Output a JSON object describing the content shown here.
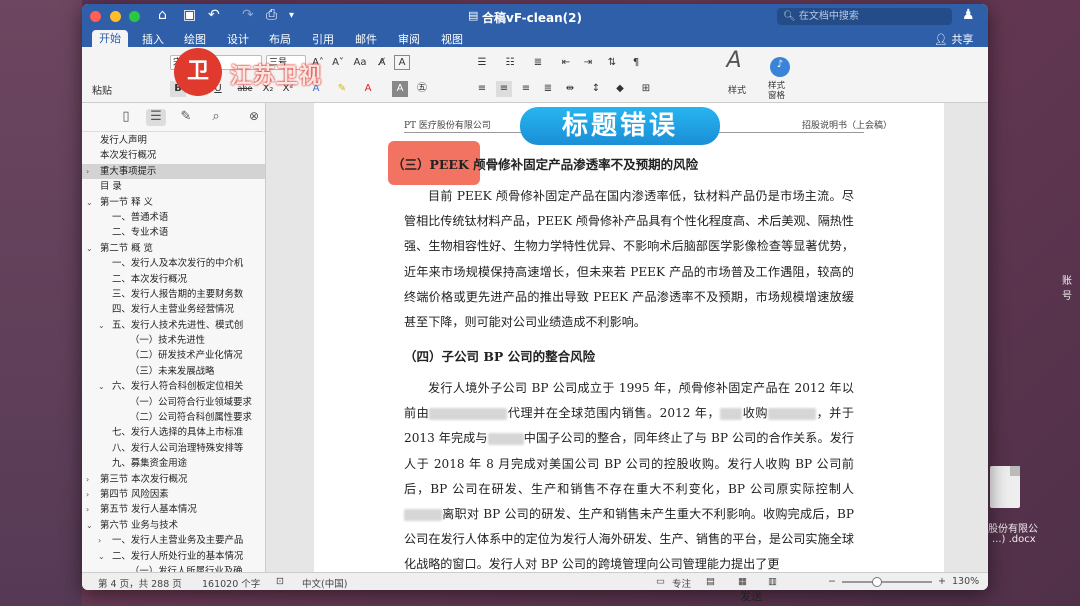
{
  "window": {
    "title": "合稿vF-clean(2)",
    "search_placeholder": "在文档中搜索"
  },
  "tabs": [
    "开始",
    "插入",
    "绘图",
    "设计",
    "布局",
    "引用",
    "邮件",
    "审阅",
    "视图"
  ],
  "share_label": "共享",
  "ribbon": {
    "paste_label": "粘贴",
    "font_name": "宋体",
    "font_size": "三号",
    "styles_label": "样式",
    "styles_pane_label": "样式\n窗格"
  },
  "watermark": {
    "logo_text": "江苏卫视"
  },
  "toc": [
    {
      "label": "发行人声明",
      "indent": 1,
      "arrow": ""
    },
    {
      "label": "本次发行概况",
      "indent": 1,
      "arrow": ""
    },
    {
      "label": "重大事项提示",
      "indent": 1,
      "arrow": "›",
      "selected": true
    },
    {
      "label": "目  录",
      "indent": 1,
      "arrow": ""
    },
    {
      "label": "第一节  释  义",
      "indent": 1,
      "arrow": "⌄"
    },
    {
      "label": "一、普通术语",
      "indent": 2,
      "arrow": ""
    },
    {
      "label": "二、专业术语",
      "indent": 2,
      "arrow": ""
    },
    {
      "label": "第二节  概  览",
      "indent": 1,
      "arrow": "⌄"
    },
    {
      "label": "一、发行人及本次发行的中介机",
      "indent": 2,
      "arrow": ""
    },
    {
      "label": "二、本次发行概况",
      "indent": 2,
      "arrow": ""
    },
    {
      "label": "三、发行人报告期的主要财务数",
      "indent": 2,
      "arrow": ""
    },
    {
      "label": "四、发行人主营业务经营情况",
      "indent": 2,
      "arrow": ""
    },
    {
      "label": "五、发行人技术先进性、模式创",
      "indent": 2,
      "arrow": "⌄"
    },
    {
      "label": "（一）技术先进性",
      "indent": 3,
      "arrow": ""
    },
    {
      "label": "（二）研发技术产业化情况",
      "indent": 3,
      "arrow": ""
    },
    {
      "label": "（三）未来发展战略",
      "indent": 3,
      "arrow": ""
    },
    {
      "label": "六、发行人符合科创板定位相关",
      "indent": 2,
      "arrow": "⌄"
    },
    {
      "label": "（一）公司符合行业领域要求",
      "indent": 3,
      "arrow": ""
    },
    {
      "label": "（二）公司符合科创属性要求",
      "indent": 3,
      "arrow": ""
    },
    {
      "label": "七、发行人选择的具体上市标准",
      "indent": 2,
      "arrow": ""
    },
    {
      "label": "八、发行人公司治理特殊安排等",
      "indent": 2,
      "arrow": ""
    },
    {
      "label": "九、募集资金用途",
      "indent": 2,
      "arrow": ""
    },
    {
      "label": "第三节  本次发行概况",
      "indent": 1,
      "arrow": "›"
    },
    {
      "label": "第四节  风险因素",
      "indent": 1,
      "arrow": "›"
    },
    {
      "label": "第五节  发行人基本情况",
      "indent": 1,
      "arrow": "›"
    },
    {
      "label": "第六节  业务与技术",
      "indent": 1,
      "arrow": "⌄"
    },
    {
      "label": "一、发行人主营业务及主要产品",
      "indent": 2,
      "arrow": "›"
    },
    {
      "label": "二、发行人所处行业的基本情况",
      "indent": 2,
      "arrow": "⌄"
    },
    {
      "label": "（一）发行人所属行业及确",
      "indent": 3,
      "arrow": ""
    }
  ],
  "document": {
    "header_left": "PT  医疗股份有限公司",
    "header_right": "招股说明书（上会稿）",
    "banner": "标题错误",
    "section3_heading": "（三）PEEK 颅骨修补固定产品渗透率不及预期的风险",
    "section3_text": "目前 PEEK 颅骨修补固定产品在国内渗透率低，钛材料产品仍是市场主流。尽管相比传统钛材料产品，PEEK 颅骨修补产品具有个性化程度高、术后美观、隔热性强、生物相容性好、生物力学特性优异、不影响术后脑部医学影像检查等显著优势，近年来市场规模保持高速增长，但未来若 PEEK 产品的市场普及工作遇阻，较高的终端价格或更先进产品的推出导致 PEEK 产品渗透率不及预期，市场规模增速放缓甚至下降，则可能对公司业绩造成不利影响。",
    "section4_heading": "（四）子公司 BP 公司的整合风险",
    "section4_text_1": "发行人境外子公司 BP 公司成立于 1995 年，颅骨修补固定产品在 2012 年以前由",
    "section4_text_2": "代理并在全球范围内销售。2012 年，",
    "section4_text_3": "收购",
    "section4_text_4": "，并于 2013 年完成与",
    "section4_text_5": "中国子公司的整合，同年终止了与 BP 公司的合作关系。发行人于 2018 年 8 月完成对美国公司 BP 公司的控股收购。发行人收购 BP 公司前后，BP 公司在研发、生产和销售不存在重大不利变化，BP 公司原实际控制人",
    "section4_text_6": "离职对 BP 公司的研发、生产和销售未产生重大不利影响。收购完成后，BP 公司在发行人体系中的定位为发行人海外研发、生产、销售的平台，是公司实施全球化战略的窗口。发行人对 BP 公司的跨境管理向公司管理能力提出了更"
  },
  "statusbar": {
    "page": "第 4 页，共 288 页",
    "words": "161020 个字",
    "language": "中文(中国)",
    "focus": "专注",
    "zoom": "130%"
  },
  "desktop": {
    "right_label_1": "账号",
    "file_name_1": "股份有限公",
    "file_name_2": "...) .docx",
    "send_label": "发送"
  },
  "colors": {
    "title_blue": "#2e5fa8",
    "highlight": "#f05a46",
    "banner": "#1a8fd6"
  }
}
